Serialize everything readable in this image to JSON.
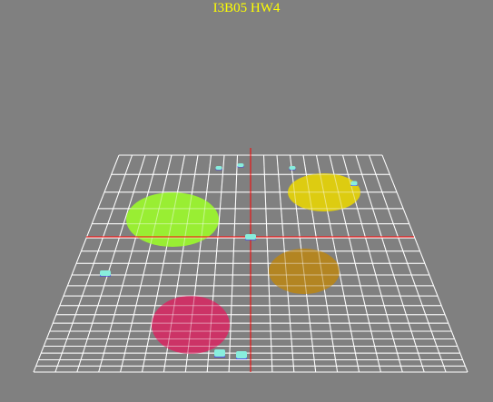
{
  "window": {
    "title": "I3B05 HW4"
  },
  "scene": {
    "background": "#808080",
    "grid": {
      "color": "#ffffff",
      "divisions": 20
    },
    "axes": {
      "color": "#ff0000"
    },
    "discs": [
      {
        "name": "green-disc",
        "color": "#99ee33"
      },
      {
        "name": "yellow-disc",
        "color": "#ddcc11"
      },
      {
        "name": "orange-disc",
        "color": "#b38522"
      },
      {
        "name": "pink-disc",
        "color": "#cc3366"
      }
    ],
    "markers": [
      {
        "name": "marker-back-1"
      },
      {
        "name": "marker-back-2"
      },
      {
        "name": "marker-back-3"
      },
      {
        "name": "marker-right-edge"
      },
      {
        "name": "marker-center"
      },
      {
        "name": "marker-left"
      },
      {
        "name": "marker-front-1"
      },
      {
        "name": "marker-front-2"
      }
    ],
    "marker_colors": {
      "top": "#88eedd",
      "side": "#4444ee"
    }
  }
}
